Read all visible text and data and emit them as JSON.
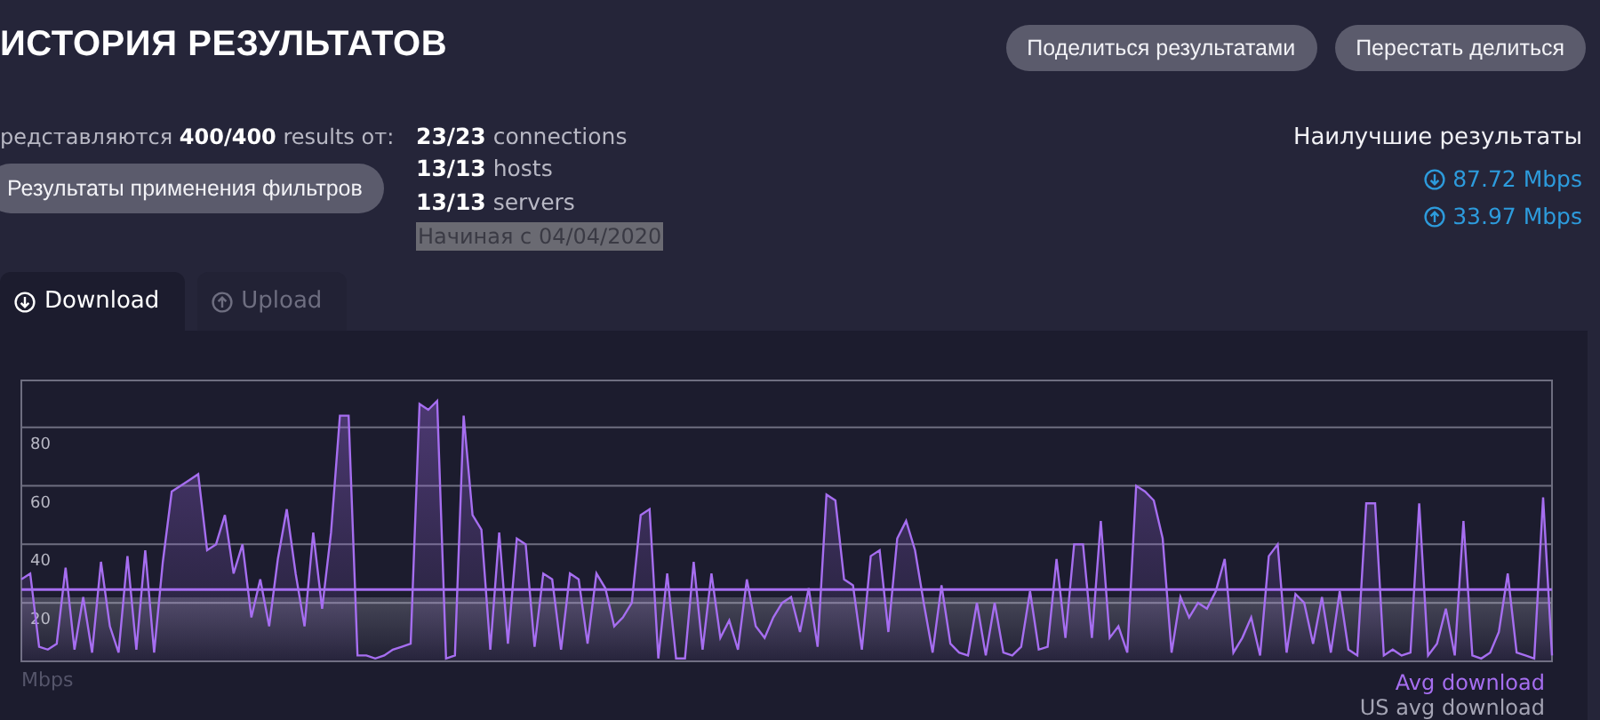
{
  "title": "ИСТОРИЯ РЕЗУЛЬТАТОВ",
  "share_buttons": [
    "Поделиться результатами",
    "Перестать делиться"
  ],
  "summary": {
    "shown": "редставляются **400/400** results от:",
    "filter_button": "Результаты применения фильтров"
  },
  "counts": [
    "**23/23** connections",
    "**13/13** hosts",
    "**13/13** servers"
  ],
  "since": {
    "label": "Начиная с",
    "date": "04/04/2020"
  },
  "best": {
    "title": "Наилучшие результаты",
    "results": [
      {
        "kind": "download",
        "value": "87.72 Mbps"
      },
      {
        "kind": "upload",
        "value": "33.97 Mbps"
      }
    ]
  },
  "tabs": [
    {
      "kind": "download",
      "label": "Download",
      "selected": true
    },
    {
      "kind": "upload",
      "label": "Upload",
      "selected": false
    }
  ],
  "chart": {
    "legend": [
      {
        "label": "Avg download",
        "color": "#a66ef0"
      },
      {
        "label": "US avg download",
        "color": "#a4a4b4"
      }
    ],
    "unit": "Mbps",
    "chart_data": {
      "type": "area",
      "ylim": [
        0,
        96
      ],
      "yticks": [
        20,
        40,
        60,
        80
      ],
      "grid": true,
      "ref_lines": [
        {
          "axis": "y",
          "value": 24.5,
          "color": "#a66ef0"
        }
      ],
      "series": [
        {
          "color": "#a66ef0",
          "values": [
            28,
            30,
            5,
            4,
            6,
            32,
            4,
            22,
            3,
            34,
            12,
            3,
            36,
            4,
            38,
            3,
            34,
            58,
            60,
            62,
            64,
            38,
            40,
            50,
            30,
            40,
            15,
            28,
            12,
            35,
            52,
            30,
            12,
            44,
            18,
            44,
            84,
            84,
            2,
            2,
            1,
            2,
            4,
            5,
            6,
            88,
            86,
            89,
            1,
            2,
            84,
            50,
            45,
            4,
            44,
            6,
            42,
            40,
            5,
            30,
            28,
            4,
            30,
            28,
            6,
            30,
            25,
            12,
            15,
            20,
            50,
            52,
            1,
            30,
            1,
            1,
            34,
            4,
            30,
            8,
            14,
            4,
            28,
            12,
            8,
            15,
            20,
            22,
            10,
            25,
            5,
            57,
            55,
            28,
            26,
            4,
            36,
            38,
            10,
            42,
            48,
            38,
            20,
            3,
            26,
            6,
            3,
            2,
            20,
            2,
            20,
            3,
            2,
            5,
            24,
            4,
            5,
            35,
            8,
            40,
            40,
            8,
            48,
            8,
            12,
            3,
            60,
            58,
            55,
            42,
            3,
            22,
            15,
            20,
            18,
            24,
            35,
            3,
            8,
            15,
            2,
            36,
            40,
            3,
            23,
            20,
            6,
            22,
            3,
            24,
            4,
            2,
            54,
            54,
            2,
            4,
            2,
            3,
            54,
            2,
            6,
            18,
            2,
            48,
            2,
            1,
            3,
            10,
            30,
            3,
            2,
            1,
            56,
            2
          ]
        }
      ]
    }
  }
}
